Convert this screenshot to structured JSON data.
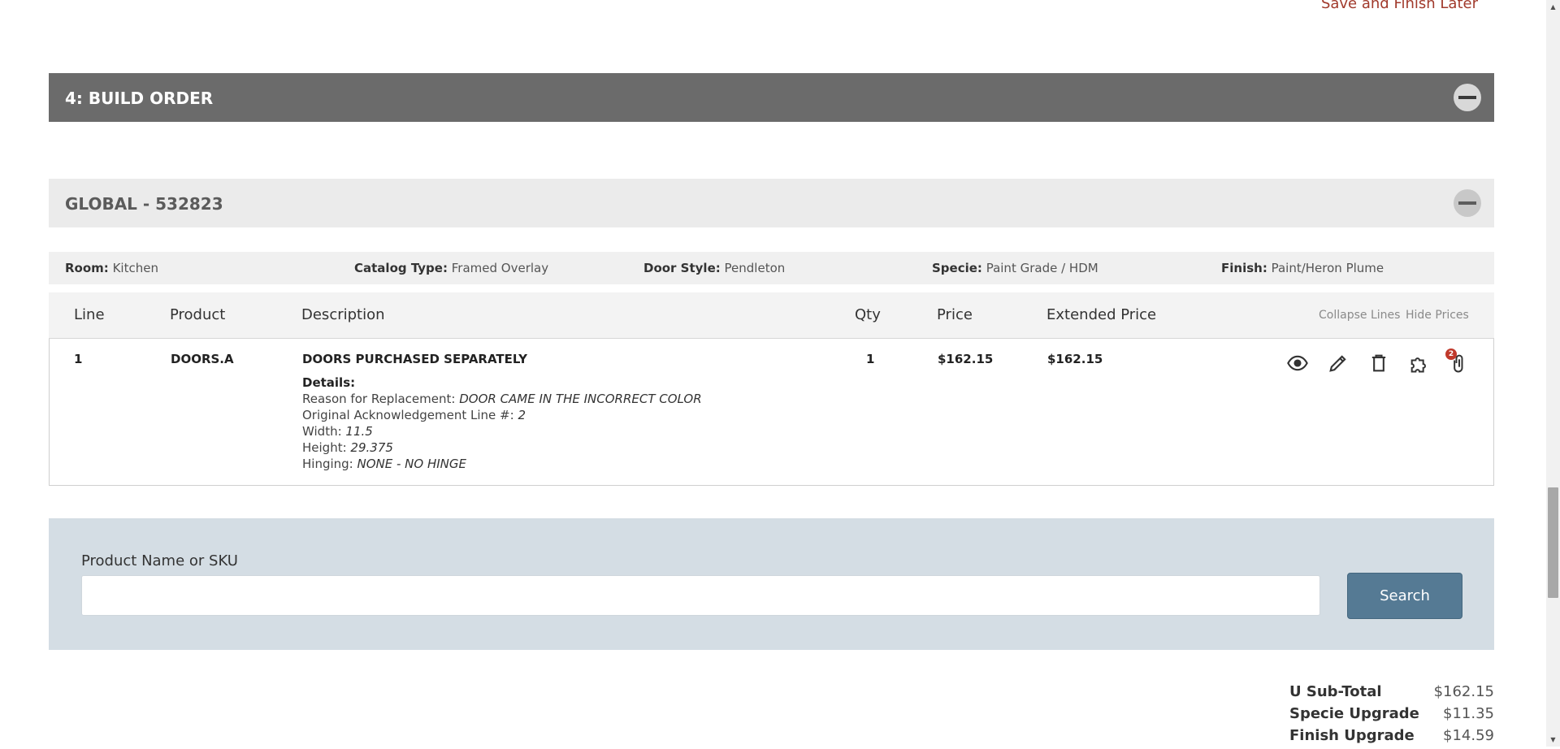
{
  "top": {
    "save_later": "Save and Finish Later"
  },
  "build_order": {
    "title": "4: BUILD ORDER"
  },
  "group": {
    "title": "GLOBAL - 532823"
  },
  "info": {
    "room_label": "Room:",
    "room_value": "Kitchen",
    "catalog_label": "Catalog Type:",
    "catalog_value": "Framed Overlay",
    "door_label": "Door Style:",
    "door_value": "Pendleton",
    "specie_label": "Specie:",
    "specie_value": "Paint Grade / HDM",
    "finish_label": "Finish:",
    "finish_value": "Paint/Heron Plume"
  },
  "table": {
    "headers": {
      "line": "Line",
      "product": "Product",
      "description": "Description",
      "qty": "Qty",
      "price": "Price",
      "extended": "Extended Price"
    },
    "links": {
      "collapse": "Collapse Lines",
      "hide_prices": "Hide Prices"
    },
    "rows": [
      {
        "line": "1",
        "product": "DOORS.A",
        "description": "DOORS PURCHASED SEPARATELY",
        "qty": "1",
        "price": "$162.15",
        "extended": "$162.15",
        "details_label": "Details:",
        "details": [
          {
            "label": "Reason for Replacement: ",
            "value": "DOOR CAME IN THE INCORRECT COLOR"
          },
          {
            "label": "Original Acknowledgement Line #: ",
            "value": "2"
          },
          {
            "label": "Width: ",
            "value": "11.5"
          },
          {
            "label": "Height: ",
            "value": "29.375"
          },
          {
            "label": "Hinging: ",
            "value": "NONE - NO HINGE"
          }
        ],
        "attachment_count": "2",
        "icons": [
          "eye-icon",
          "pencil-icon",
          "trash-icon",
          "puzzle-icon",
          "paperclip-icon"
        ]
      }
    ]
  },
  "search": {
    "label": "Product Name or SKU",
    "value": "",
    "placeholder": "",
    "button": "Search"
  },
  "totals": [
    {
      "label": "U Sub-Total",
      "value": "$162.15"
    },
    {
      "label": "Specie Upgrade",
      "value": "$11.35"
    },
    {
      "label": "Finish Upgrade",
      "value": "$14.59"
    }
  ],
  "colors": {
    "header_dark": "#6b6b6b",
    "header_light": "#ebebeb",
    "search_panel": "#d4dde4",
    "search_button": "#557a94",
    "link_red": "#a13a2c",
    "badge_red": "#c0392b"
  }
}
